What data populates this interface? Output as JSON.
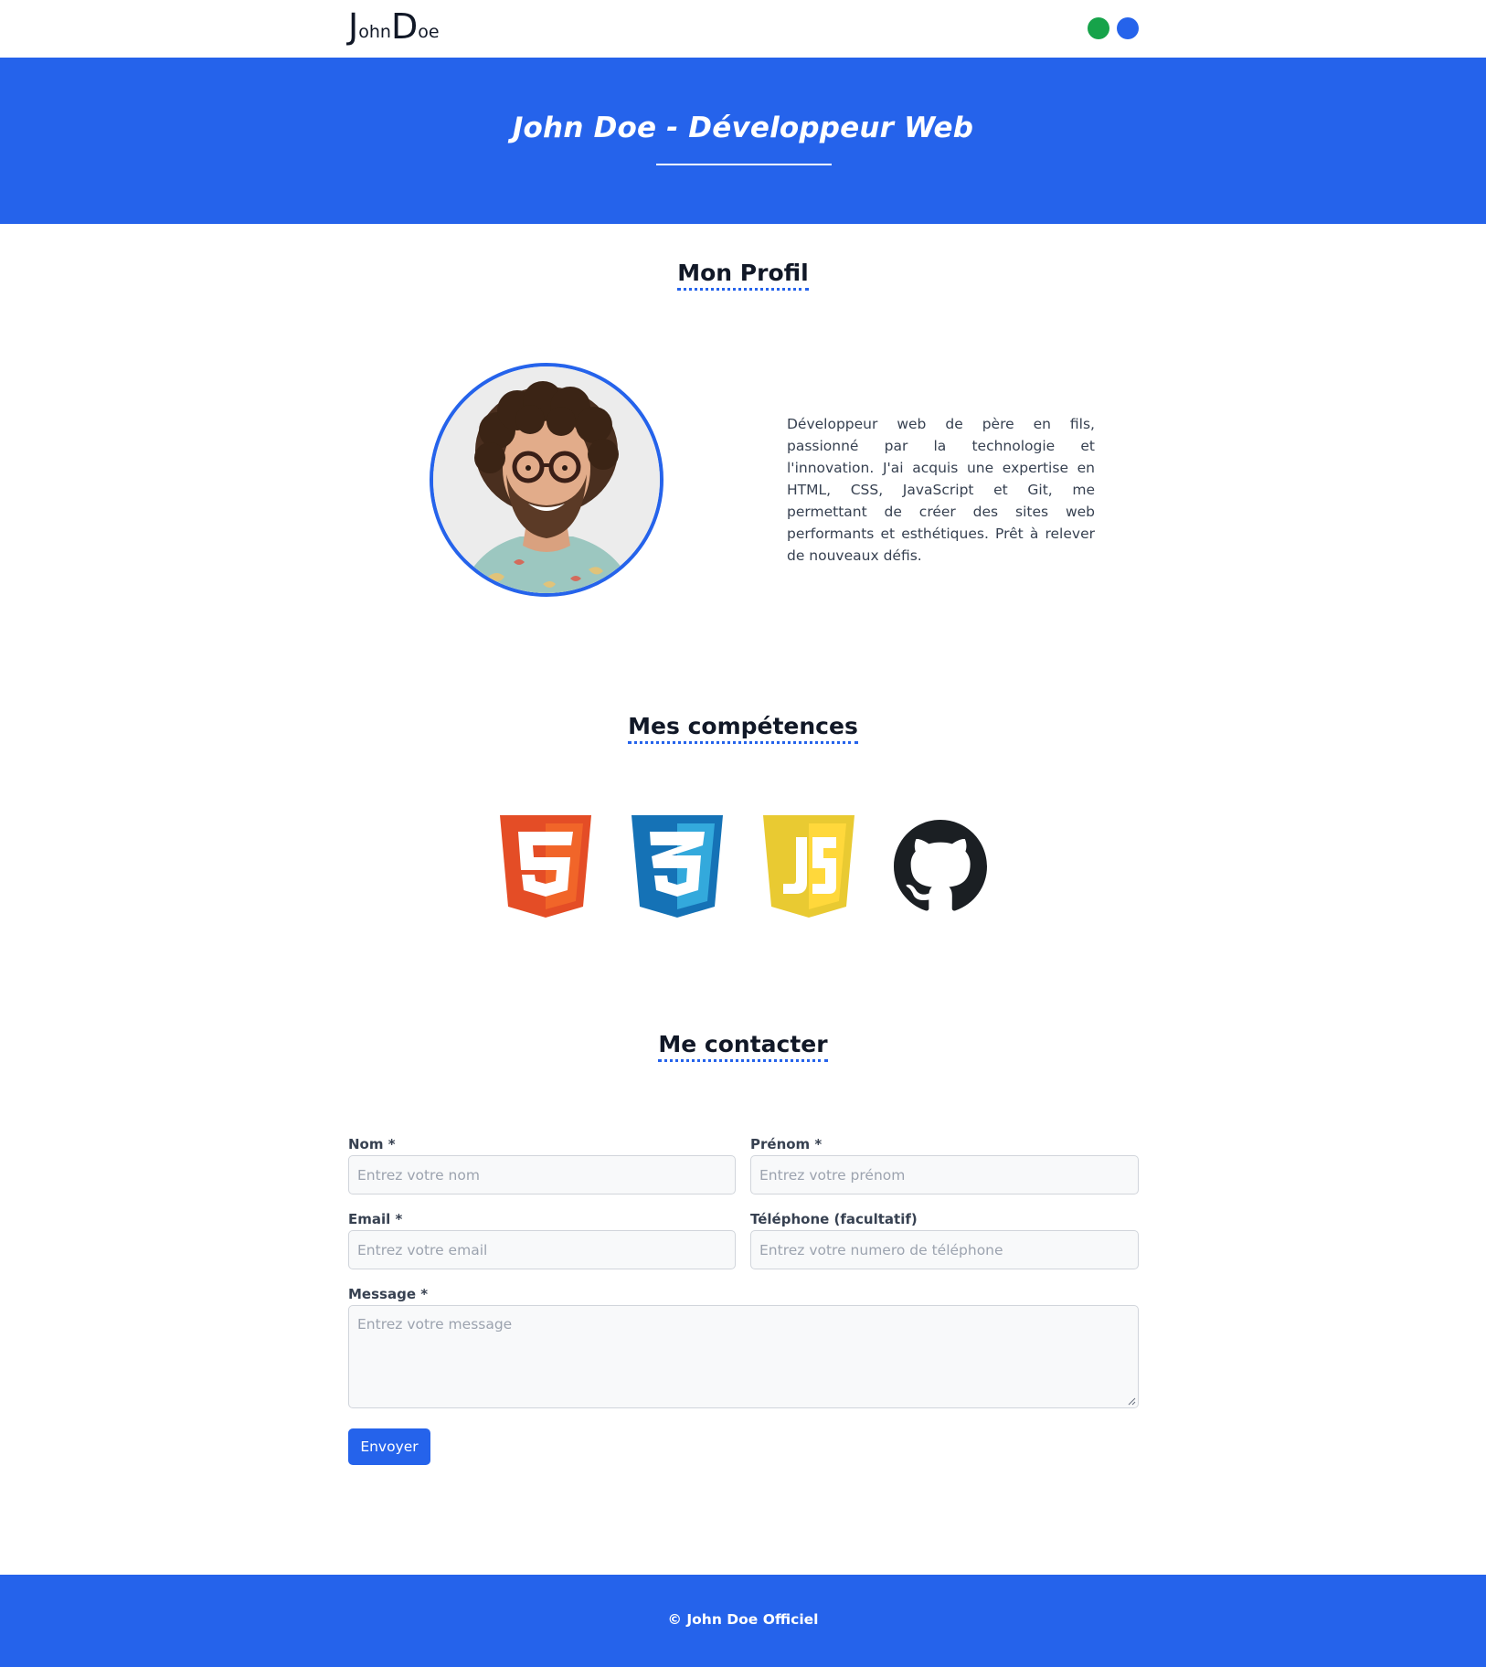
{
  "header": {
    "logo_first_initial": "J",
    "logo_first_rest": "ohn",
    "logo_last_initial": "D",
    "logo_last_rest": "oe",
    "theme_dots": [
      {
        "name": "green",
        "color": "#16a34a"
      },
      {
        "name": "blue",
        "color": "#2563eb"
      }
    ]
  },
  "hero": {
    "title": "John Doe - Développeur Web"
  },
  "profile": {
    "title": "Mon Profil",
    "bio": "Développeur web de père en fils, passionné par la technologie et l'innovation. J'ai acquis une expertise en HTML, CSS, JavaScript et Git, me permettant de créer des sites web performants et esthétiques. Prêt à relever de nouveaux défis."
  },
  "skills": {
    "title": "Mes compétences",
    "icons": [
      "html5-icon",
      "css3-icon",
      "javascript-icon",
      "github-icon"
    ]
  },
  "contact": {
    "title": "Me contacter",
    "nom_label": "Nom *",
    "nom_placeholder": "Entrez votre nom",
    "prenom_label": "Prénom *",
    "prenom_placeholder": "Entrez votre prénom",
    "email_label": "Email *",
    "email_placeholder": "Entrez votre email",
    "phone_label": "Téléphone (facultatif)",
    "phone_placeholder": "Entrez votre numero de téléphone",
    "message_label": "Message *",
    "message_placeholder": "Entrez votre message",
    "submit_label": "Envoyer"
  },
  "footer": {
    "text": "© John Doe Officiel"
  },
  "colors": {
    "primary": "#2563eb",
    "accent_green": "#16a34a"
  }
}
